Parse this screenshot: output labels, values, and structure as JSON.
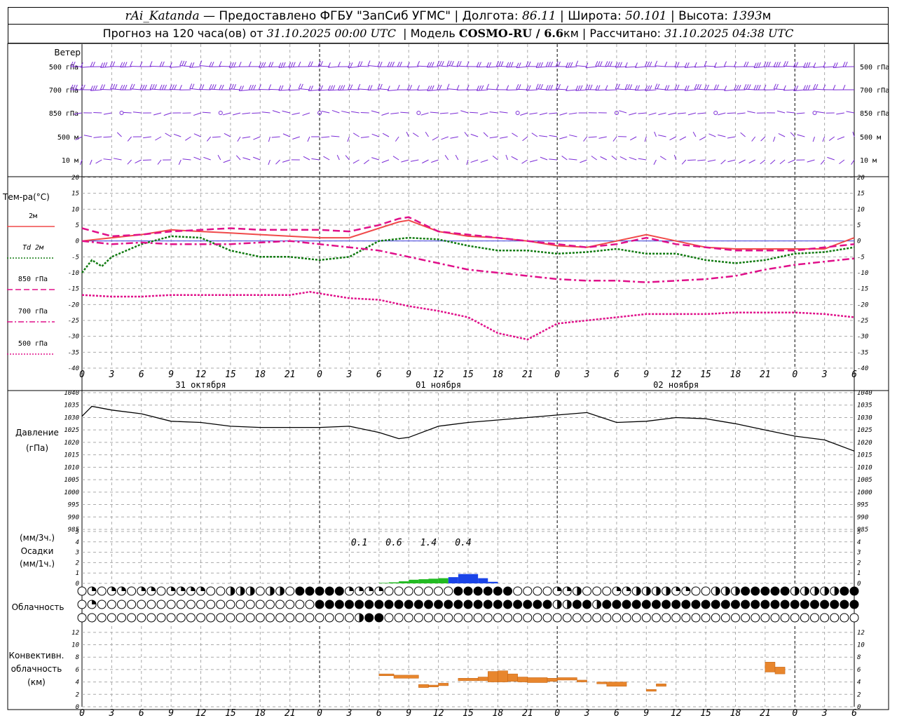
{
  "header": {
    "station": "rAi_Katanda",
    "provided_by": "— Предоставлено ФГБУ \"ЗапСиб УГМС\"",
    "lon_label": "Долгота:",
    "lon_value": "86.11",
    "lat_label": "Широта:",
    "lat_value": "50.101",
    "alt_label": "Высота:",
    "alt_value": "1393",
    "alt_unit": "м",
    "forecast_text": "Прогноз на 120 часа(ов) от",
    "forecast_start": "31.10.2025 00:00 UTC",
    "model_label": "Модель",
    "model_name": "COSMO-RU / 6.6",
    "model_unit": "км",
    "calc_label": "Рассчитано:",
    "calc_time": "31.10.2025 04:38 UTC"
  },
  "wind": {
    "title": "Ветер",
    "levels": [
      "500 гПа",
      "700 гПа",
      "850 гПа",
      "500 м",
      "10 м"
    ],
    "color": "#7b2bd6"
  },
  "temperature": {
    "title": "Тем-ра(°С)",
    "legend": [
      {
        "label": "2м",
        "color": "#f04a4a",
        "style": "solid"
      },
      {
        "label": "Td  2м",
        "color": "#107a10",
        "style": "dotted"
      },
      {
        "label": "850 гПа",
        "color": "#e0108a",
        "style": "dashed"
      },
      {
        "label": "700 гПа",
        "color": "#e0108a",
        "style": "dashdot"
      },
      {
        "label": "500 гПа",
        "color": "#e0108a",
        "style": "dotted"
      }
    ],
    "y_ticks": [
      "20",
      "15",
      "10",
      "5",
      "0",
      "-5",
      "-10",
      "-15",
      "-20",
      "-25",
      "-30",
      "-35",
      "-40"
    ]
  },
  "time_axis": {
    "hour_labels": [
      "0",
      "3",
      "6",
      "9",
      "12",
      "15",
      "18",
      "21",
      "0",
      "3",
      "6",
      "9",
      "12",
      "15",
      "18",
      "21",
      "0",
      "3",
      "6",
      "9",
      "12",
      "15",
      "18",
      "21",
      "0",
      "3",
      "6"
    ],
    "days": [
      "31 октября",
      "01 ноября",
      "02 ноября"
    ]
  },
  "pressure": {
    "title": "Давление",
    "unit": "(гПа)",
    "y_ticks": [
      "1040",
      "1035",
      "1030",
      "1025",
      "1020",
      "1015",
      "1010",
      "1005",
      "1000",
      "995",
      "990",
      "985"
    ]
  },
  "precip": {
    "unit3": "(мм/3ч.)",
    "title": "Осадки",
    "unit1": "(мм/1ч.)",
    "y_ticks": [
      "5",
      "4",
      "3",
      "2",
      "1",
      "0"
    ],
    "totals": [
      "0.1",
      "0.6",
      "1.4",
      "0.4"
    ]
  },
  "clouds": {
    "title": "Облачность"
  },
  "convective": {
    "title1": "Конвективн.",
    "title2": "облачность",
    "unit": "(км)",
    "y_ticks": [
      "12",
      "10",
      "8",
      "6",
      "4",
      "2",
      "0"
    ]
  },
  "chart_data": [
    {
      "type": "line",
      "title": "Тем-ра(°С)",
      "x_unit": "hours since 31.10.2025 00:00 UTC",
      "ylim": [
        -40,
        20
      ],
      "series": [
        {
          "name": "2м",
          "x": [
            0,
            3,
            6,
            9,
            12,
            15,
            18,
            21,
            24,
            27,
            30,
            32,
            33,
            36,
            39,
            42,
            45,
            48,
            51,
            54,
            57,
            60,
            63,
            66,
            69,
            72,
            75,
            78
          ],
          "y": [
            0,
            1,
            2,
            3.5,
            3,
            2.5,
            2,
            1.5,
            1,
            1,
            4,
            6,
            6.5,
            3,
            1.5,
            1,
            0,
            -1.5,
            -2,
            0,
            2,
            0,
            -2,
            -2.5,
            -2.5,
            -2.5,
            -2.5,
            1
          ]
        },
        {
          "name": "Td  2м",
          "x": [
            0,
            1,
            2,
            3,
            6,
            9,
            12,
            15,
            18,
            21,
            24,
            27,
            30,
            33,
            36,
            39,
            42,
            45,
            48,
            51,
            54,
            57,
            60,
            63,
            66,
            69,
            72,
            75,
            78
          ],
          "y": [
            -10,
            -6,
            -8,
            -5,
            -1,
            1.5,
            1,
            -3,
            -5,
            -5,
            -6,
            -5,
            0,
            1,
            0.5,
            -1.5,
            -3,
            -3,
            -4,
            -3.5,
            -2.5,
            -4,
            -4,
            -6,
            -7,
            -6,
            -4,
            -3.5,
            -2
          ]
        },
        {
          "name": "850 гПа",
          "x": [
            0,
            3,
            6,
            9,
            12,
            15,
            18,
            21,
            24,
            27,
            30,
            32,
            33,
            36,
            39,
            42,
            45,
            48,
            51,
            54,
            57,
            60,
            63,
            66,
            69,
            72,
            75,
            78
          ],
          "y": [
            4,
            1.5,
            2,
            3,
            3.5,
            4,
            3.5,
            3.5,
            3.5,
            3,
            5,
            7,
            7.5,
            3,
            2,
            1,
            0,
            -1,
            -2,
            -1,
            1,
            -1,
            -2,
            -3,
            -3,
            -3,
            -2,
            -1
          ]
        },
        {
          "name": "700 гПа",
          "x": [
            0,
            3,
            6,
            9,
            12,
            15,
            18,
            21,
            24,
            27,
            30,
            33,
            36,
            39,
            42,
            45,
            48,
            51,
            54,
            57,
            60,
            63,
            66,
            69,
            72,
            75,
            78
          ],
          "y": [
            0,
            -1,
            -0.5,
            -1,
            -1,
            -1,
            -0.5,
            0,
            -1,
            -2,
            -3,
            -5,
            -7,
            -9,
            -10,
            -11,
            -12,
            -12.5,
            -12.5,
            -13,
            -12.5,
            -12,
            -11,
            -9,
            -7.5,
            -6.5,
            -5.5
          ]
        },
        {
          "name": "500 гПа",
          "x": [
            0,
            3,
            6,
            9,
            12,
            15,
            18,
            21,
            23,
            24,
            27,
            30,
            33,
            36,
            39,
            42,
            45,
            48,
            51,
            54,
            57,
            60,
            63,
            66,
            69,
            72,
            75,
            78
          ],
          "y": [
            -17,
            -17.5,
            -17.5,
            -17,
            -17,
            -17,
            -17,
            -17,
            -16,
            -16.5,
            -18,
            -18.5,
            -20.5,
            -22,
            -24,
            -29,
            -31,
            -26,
            -25,
            -24,
            -23,
            -23,
            -23,
            -22.5,
            -22.5,
            -22.5,
            -23,
            -24
          ]
        }
      ]
    },
    {
      "type": "line",
      "title": "Давление",
      "x_unit": "hours since 31.10.2025 00:00 UTC",
      "ylim": [
        985,
        1040
      ],
      "series": [
        {
          "name": "",
          "x": [
            0,
            1,
            3,
            6,
            9,
            12,
            15,
            18,
            21,
            24,
            27,
            30,
            32,
            33,
            36,
            39,
            42,
            45,
            48,
            51,
            54,
            57,
            60,
            63,
            66,
            69,
            72,
            75,
            78
          ],
          "y": [
            1030.5,
            1034.5,
            1033,
            1031.5,
            1028.5,
            1028,
            1026.5,
            1026,
            1026,
            1026,
            1026.5,
            1024,
            1021.5,
            1022,
            1026.5,
            1028,
            1029,
            1030,
            1031,
            1032,
            1028,
            1028.5,
            1030,
            1029.5,
            1027.5,
            1025,
            1022.5,
            1021,
            1016.5
          ]
        }
      ]
    },
    {
      "type": "bar",
      "title": "Осадки",
      "x_unit": "hours since 31.10.2025 00:00 UTC",
      "ylim": [
        0,
        5
      ],
      "series": [
        {
          "name": "",
          "color": "#22bb22",
          "x": [
            30,
            31,
            32,
            33,
            34,
            35,
            36
          ],
          "values": [
            0.05,
            0.1,
            0.2,
            0.35,
            0.4,
            0.45,
            0.5
          ]
        },
        {
          "name": "",
          "color": "#1a44e8",
          "x": [
            37,
            38,
            39,
            40,
            41
          ],
          "values": [
            0.6,
            0.9,
            0.9,
            0.5,
            0.15
          ]
        }
      ]
    },
    {
      "type": "bar",
      "title": "Конвективн. облачность",
      "x_unit": "hours since 31.10.2025 00:00 UTC",
      "ylim": [
        0,
        13
      ],
      "bars": [
        {
          "x0": 30,
          "x1": 31.5,
          "base": 5,
          "top": 5.3
        },
        {
          "x0": 31.5,
          "x1": 34,
          "base": 4.6,
          "top": 5.1
        },
        {
          "x0": 34,
          "x1": 35,
          "base": 3.1,
          "top": 3.6
        },
        {
          "x0": 35,
          "x1": 36,
          "base": 3.2,
          "top": 3.5
        },
        {
          "x0": 36,
          "x1": 37,
          "base": 3.4,
          "top": 3.8
        },
        {
          "x0": 38,
          "x1": 40,
          "base": 4.2,
          "top": 4.6
        },
        {
          "x0": 40,
          "x1": 41,
          "base": 4.2,
          "top": 4.8
        },
        {
          "x0": 41,
          "x1": 42,
          "base": 4.0,
          "top": 5.7
        },
        {
          "x0": 42,
          "x1": 43,
          "base": 4.0,
          "top": 5.8
        },
        {
          "x0": 43,
          "x1": 44,
          "base": 4.1,
          "top": 5.3
        },
        {
          "x0": 44,
          "x1": 45,
          "base": 4.0,
          "top": 4.8
        },
        {
          "x0": 45,
          "x1": 47,
          "base": 3.9,
          "top": 4.7
        },
        {
          "x0": 47,
          "x1": 48,
          "base": 4.1,
          "top": 4.6
        },
        {
          "x0": 48,
          "x1": 50,
          "base": 4.3,
          "top": 4.7
        },
        {
          "x0": 50,
          "x1": 51,
          "base": 4.0,
          "top": 4.3
        },
        {
          "x0": 52,
          "x1": 53,
          "base": 3.7,
          "top": 4.0
        },
        {
          "x0": 53,
          "x1": 55,
          "base": 3.3,
          "top": 4.0
        },
        {
          "x0": 57,
          "x1": 58,
          "base": 2.5,
          "top": 2.8
        },
        {
          "x0": 58,
          "x1": 59,
          "base": 3.3,
          "top": 3.7
        },
        {
          "x0": 69,
          "x1": 70,
          "base": 5.6,
          "top": 7.2
        },
        {
          "x0": 70,
          "x1": 71,
          "base": 5.3,
          "top": 6.4
        }
      ]
    }
  ]
}
